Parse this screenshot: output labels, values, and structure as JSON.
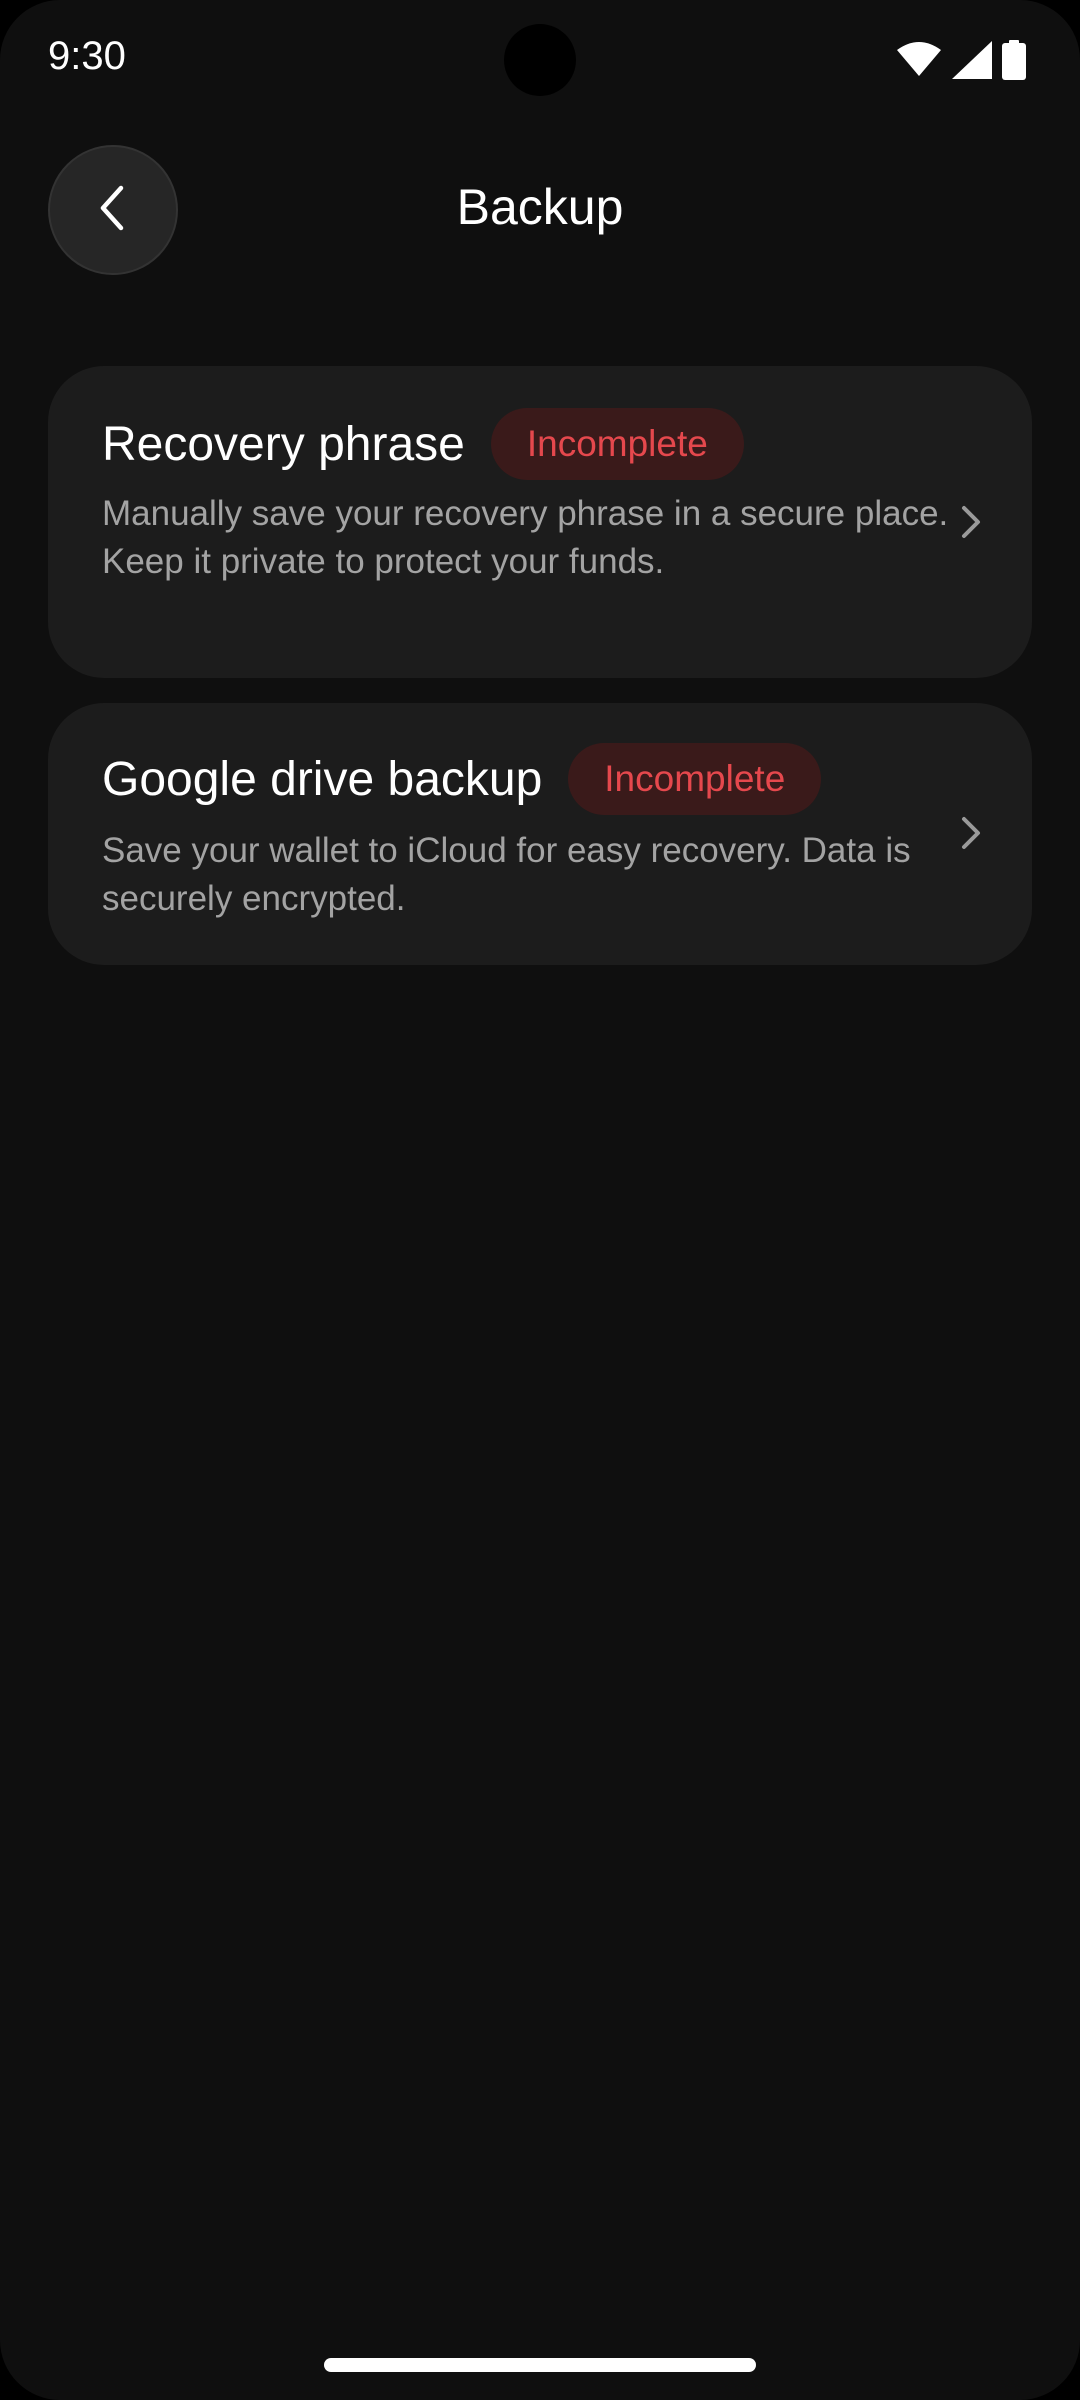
{
  "status_bar": {
    "time": "9:30",
    "icons": [
      "wifi-icon",
      "signal-icon",
      "battery-icon"
    ]
  },
  "header": {
    "title": "Backup",
    "back_icon": "chevron-left-icon"
  },
  "cards": [
    {
      "title": "Recovery phrase",
      "badge": "Incomplete",
      "description": "Manually save your recovery phrase in a secure place. Keep it private to protect your funds.",
      "icon": "chevron-right-icon"
    },
    {
      "title": "Google drive backup",
      "badge": "Incomplete",
      "description": "Save your wallet to iCloud for easy recovery. Data is securely encrypted.",
      "icon": "chevron-right-icon"
    }
  ],
  "colors": {
    "background": "#0f0f0f",
    "card": "#1c1c1c",
    "badge_bg": "#3a1a1a",
    "badge_text": "#e5484d",
    "text_primary": "#ffffff",
    "text_secondary": "#a3a3a3"
  }
}
